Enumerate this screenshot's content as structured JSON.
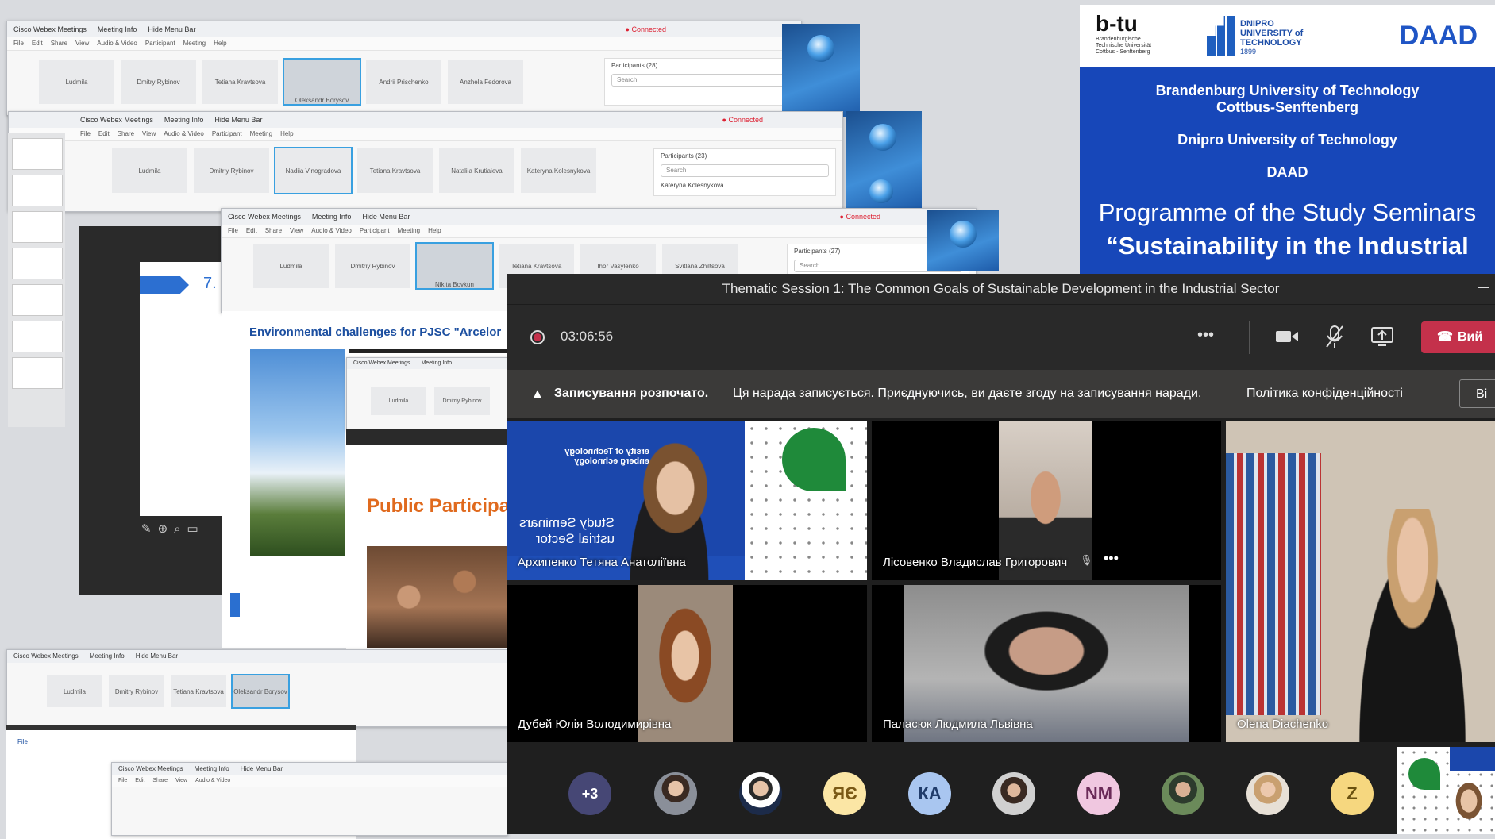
{
  "cisco": {
    "title_items": [
      "Cisco Webex Meetings",
      "Meeting Info",
      "Hide Menu Bar"
    ],
    "menu_items": [
      "File",
      "Edit",
      "Share",
      "View",
      "Audio & Video",
      "Participant",
      "Meeting",
      "Help"
    ],
    "connected": "Connected",
    "participants_1": "Participants (28)",
    "participants_2": "Participants (23)",
    "participants_3": "Participants (27)",
    "search_placeholder": "Search",
    "participant_name": "Kateryna Kolesnykova",
    "tiles_row1": [
      "Ludmila",
      "Dmitry Rybinov",
      "Tetiana Kravtsova",
      "Oleksandr Borysov",
      "Andrii Prischenko",
      "Anzhela Fedorova"
    ],
    "tiles_row2": [
      "Ludmila",
      "Dmitriy Rybinov",
      "Nadiia Vinogradova",
      "Tetiana Kravtsova",
      "Nataliia Krutiaieva",
      "Kateryna Kolesnykova"
    ],
    "tiles_row3": [
      "Ludmila",
      "Dmitriy Rybinov",
      "Nikita Bovkun",
      "Tetiana Kravtsova",
      "Ihor Vasylenko",
      "Svitlana Zhiltsova"
    ],
    "slide_env_title": "Environmental challenges for PJSC \"Arcelor",
    "slide_public_title": "Public Participa",
    "slide_number": "7."
  },
  "banner": {
    "logo_btu": "b-tu",
    "logo_btu_sub": "Brandenburgische Technische Universität Cottbus - Senftenberg",
    "logo_dnipro": "DNIPRO UNIVERSITY of TECHNOLOGY",
    "logo_dnipro_year": "1899",
    "logo_daad": "DAAD",
    "line1": "Brandenburg University of Technology",
    "line2": "Cottbus-Senftenberg",
    "line3": "Dnipro University of Technology",
    "line4": "DAAD",
    "heading1": "Programme of the Study Seminars",
    "heading2": "“Sustainability in the Industrial"
  },
  "teams": {
    "title": "Thematic Session 1: The Common Goals of Sustainable Development in the Industrial Sector",
    "timer": "03:06:56",
    "more_label": "•••",
    "leave_label": "Вий",
    "notice_bold": "Записування розпочато.",
    "notice_text": "Ця нарада записується. Приєднуючись, ви даєте згоду на записування наради.",
    "notice_link": "Політика конфіденційності",
    "notice_btn": "Ві",
    "participants": [
      "Архипенко Тетяна Анатоліївна",
      "Лісовенко Владислав Григорович",
      "Дубей Юлія Володимирівна",
      "Паласюк Людмила Львівна",
      "Olena Diachenko"
    ],
    "tile1_bg_text": "Study Seminars  ustrial Sector",
    "tile1_top_text": "ersity of Technology  enberg  echnology",
    "overflow": "+3",
    "initials": [
      "ЯЄ",
      "КА",
      "NM",
      "Z"
    ],
    "colors": {
      "record": "#c4314b",
      "leave": "#c4314b",
      "overflow": "#464775",
      "ye": "#fbe6a5",
      "ka": "#a9c6f0",
      "nm": "#f0c7e0",
      "z": "#f6d77f"
    }
  }
}
